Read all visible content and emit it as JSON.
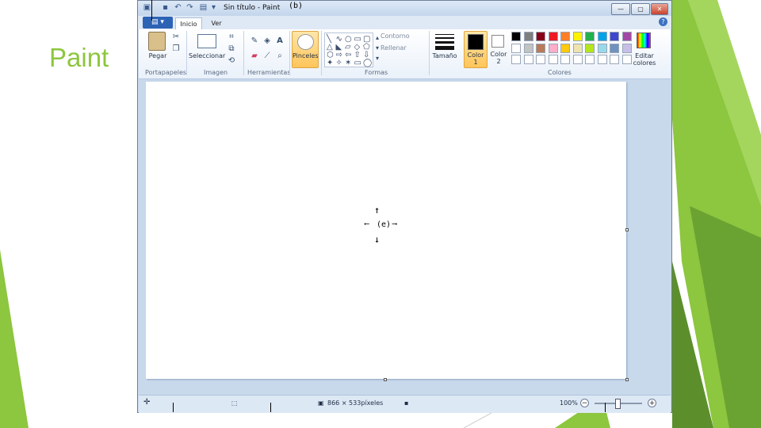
{
  "slide": {
    "title": "Paint"
  },
  "window": {
    "title": "Sin título - Paint",
    "annotation_b": "(b)",
    "quick_access": {
      "icons": [
        "paint-icon",
        "save-icon",
        "undo-icon",
        "redo-icon",
        "customize-icon"
      ],
      "chevron": "▾"
    },
    "window_buttons": [
      "—",
      "▢",
      "✕"
    ]
  },
  "tabs": {
    "app_menu_label": "▤ ▾",
    "items": [
      "Inicio",
      "Ver"
    ],
    "active": "Inicio",
    "help": "?"
  },
  "ribbon": {
    "clipboard": {
      "paste_label": "Pegar",
      "group": "Portapapeles"
    },
    "image": {
      "select_label": "Seleccionar",
      "group": "Imagen"
    },
    "tools": {
      "group": "Herramientas",
      "icons": [
        "pencil-icon",
        "fill-bucket-icon",
        "text-icon",
        "eraser-icon",
        "color-picker-icon",
        "magnifier-icon"
      ]
    },
    "brushes": {
      "label": "Pinceles"
    },
    "shapes": {
      "group": "Formas",
      "outline_label": "Contorno",
      "fill_label": "Rellenar",
      "glyphs": [
        "╲",
        "∿",
        "○",
        "▭",
        "▢",
        "△",
        "◣",
        "▱",
        "◇",
        "⬠",
        "⬡",
        "⇨",
        "⇦",
        "⇧",
        "⇩",
        "✦",
        "✧",
        "✶",
        "▭",
        "◯"
      ]
    },
    "size": {
      "label": "Tamaño"
    },
    "colors": {
      "group": "Colores",
      "color1_label": "Color 1",
      "color1": "#000000",
      "color2_label": "Color 2",
      "color2": "#ffffff",
      "edit_label": "Editar colores",
      "palette_row1": [
        "#000000",
        "#7f7f7f",
        "#880015",
        "#ed1c24",
        "#ff7f27",
        "#fff200",
        "#22b14c",
        "#00a2e8",
        "#3f48cc",
        "#a349a4"
      ],
      "palette_row2": [
        "#ffffff",
        "#c3c3c3",
        "#b97a57",
        "#ffaec9",
        "#ffc90e",
        "#efe4b0",
        "#b5e61d",
        "#99d9ea",
        "#7092be",
        "#c8bfe7"
      ],
      "palette_row3": [
        "#ffffff",
        "#ffffff",
        "#ffffff",
        "#ffffff",
        "#ffffff",
        "#ffffff",
        "#ffffff",
        "#ffffff",
        "#ffffff",
        "#ffffff"
      ]
    }
  },
  "canvas": {
    "annotation_e": "(e)",
    "arrows": {
      "up": "↑",
      "down": "↓",
      "left": "⟵",
      "right": "⟶"
    }
  },
  "status": {
    "canvas_size": "866 × 533píxeles",
    "zoom": "100%",
    "zoom_out": "−",
    "zoom_in": "+"
  },
  "colors": {
    "accent": "#8dc63f",
    "window_frame": "#c9d9ec"
  }
}
